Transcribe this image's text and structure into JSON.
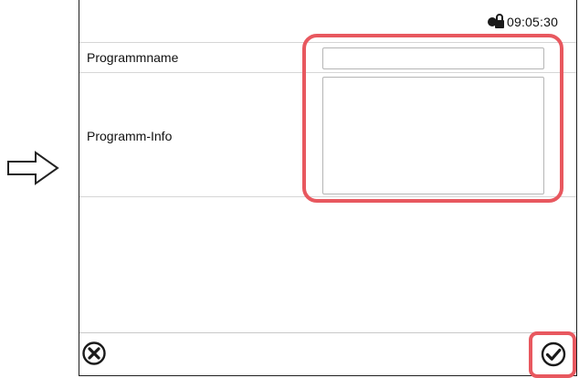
{
  "status_bar": {
    "time": "09:05:30",
    "lock_icon": "user-lock-icon"
  },
  "form": {
    "program_name_label": "Programmname",
    "program_name_value": "",
    "program_info_label": "Programm-Info",
    "program_info_value": ""
  },
  "footer": {
    "cancel_icon": "close-circle-icon",
    "confirm_icon": "check-circle-icon"
  },
  "annotations": {
    "pointer_icon": "right-arrow-icon",
    "highlight_color": "#e8585f"
  }
}
